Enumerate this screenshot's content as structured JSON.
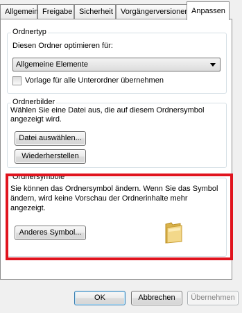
{
  "tabs": [
    "Allgemein",
    "Freigabe",
    "Sicherheit",
    "Vorgängerversionen",
    "Anpassen"
  ],
  "folder_type": {
    "title": "Ordnertyp",
    "optimize_label": "Diesen Ordner optimieren für:",
    "selected_option": "Allgemeine Elemente",
    "apply_subfolders_label": "Vorlage für alle Unterordner übernehmen"
  },
  "folder_pictures": {
    "title": "Ordnerbilder",
    "description": "Wählen Sie eine Datei aus, die auf diesem Ordnersymbol angezeigt wird.",
    "choose_file_label": "Datei auswählen...",
    "restore_label": "Wiederherstellen"
  },
  "folder_icons": {
    "title": "Ordnersymbole",
    "description": "Sie können das Ordnersymbol ändern. Wenn Sie das Symbol ändern, wird keine Vorschau der Ordnerinhalte mehr angezeigt.",
    "change_icon_label": "Anderes Symbol..."
  },
  "footer": {
    "ok_label": "OK",
    "cancel_label": "Abbrechen",
    "apply_label": "Übernehmen"
  },
  "highlight_color": "#e0141e"
}
